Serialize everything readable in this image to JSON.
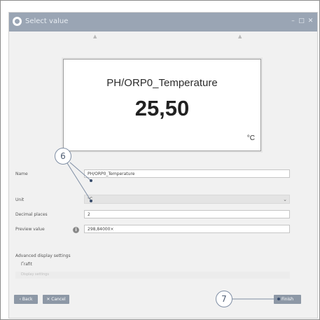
{
  "window": {
    "title": "Select value",
    "controls": {
      "minimize": "–",
      "maximize": "□",
      "close": "✕"
    }
  },
  "display": {
    "name": "PH/ORP0_Temperature",
    "value": "25,50",
    "unit": "°C"
  },
  "form": {
    "name": {
      "label": "Name",
      "value": "PH/ORP0_Temperature"
    },
    "unit": {
      "label": "Unit",
      "value": "°C"
    },
    "decimal_places": {
      "label": "Decimal places",
      "value": "2"
    },
    "preview_value": {
      "label": "Preview value",
      "value": "298,84000×"
    }
  },
  "advanced": {
    "heading": "Advanced display settings",
    "checkbox_label": "Ґrafit",
    "dimmed_row": "Display settings"
  },
  "buttons": {
    "back": "‹ Back",
    "cancel": "✕ Cancel",
    "finish": "Finish"
  },
  "callouts": {
    "six": "6",
    "seven": "7"
  },
  "colors": {
    "titlebar": "#9aa5b4",
    "button": "#8d98a6",
    "callout_border": "#7f8ea4"
  }
}
